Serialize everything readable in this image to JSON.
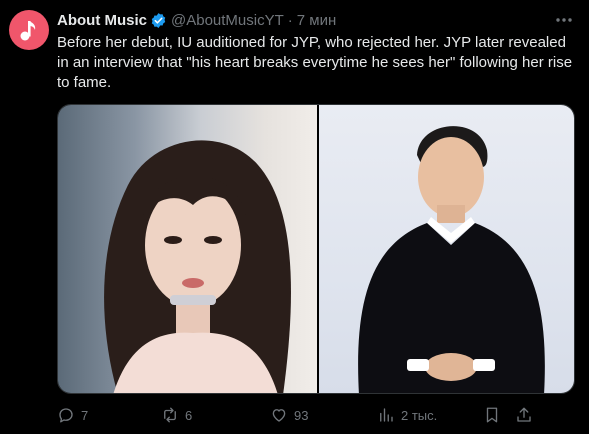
{
  "tweet": {
    "author_name": "About Music",
    "handle": "@AboutMusicYT",
    "separator": "·",
    "time": "7 мин",
    "text": "Before her debut, IU auditioned for JYP, who rejected her. JYP later revealed in an interview that \"his heart breaks everytime he sees her\" following her rise to fame.",
    "colors": {
      "background": "#000000",
      "avatar_bg": "#f0566b",
      "verified": "#1d9bf0",
      "muted": "#71767b"
    }
  },
  "actions": {
    "replies": "7",
    "reposts": "6",
    "likes": "93",
    "views": "2 тыс."
  },
  "icons": {
    "avatar": "music-note-icon",
    "verified": "verified-badge-icon",
    "more": "more-dots-icon",
    "reply": "reply-icon",
    "repost": "repost-icon",
    "like": "heart-icon",
    "views": "views-chart-icon",
    "bookmark": "bookmark-icon",
    "share": "share-icon"
  }
}
